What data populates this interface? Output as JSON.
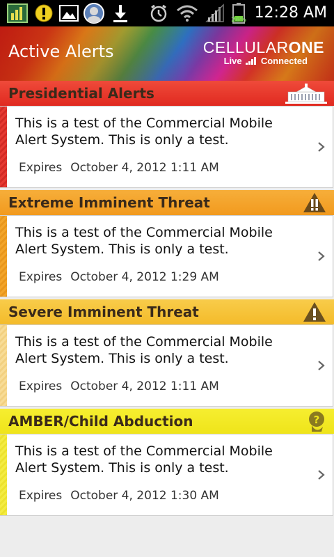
{
  "status_bar": {
    "time": "12:28 AM",
    "battery_percent": "26%",
    "icons": [
      "app-monitor-icon",
      "warning-notification-icon",
      "gallery-icon",
      "avatar-notification-icon",
      "download-icon",
      "alarm-icon",
      "wifi-icon",
      "signal-icon",
      "battery-icon"
    ]
  },
  "header": {
    "title": "Active Alerts",
    "logo_main_a": "CELLULAR",
    "logo_main_b": "ONE",
    "logo_sub_a": "Live",
    "logo_sub_b": "Connected"
  },
  "sections": [
    {
      "title": "Presidential Alerts",
      "icon": "white-house-icon",
      "color": "#e8382a",
      "strip_color": "#e02a2a",
      "alert": {
        "message": "This is a test of the Commercial Mobile Alert System. This is only a test.",
        "expires_label": "Expires",
        "expires_value": "October 4, 2012 1:11 AM"
      }
    },
    {
      "title": "Extreme Imminent Threat",
      "icon": "double-exclamation-warning-icon",
      "color": "#f4a024",
      "strip_color": "#f0a020",
      "alert": {
        "message": "This is a test of the Commercial Mobile Alert System. This is only a test.",
        "expires_label": "Expires",
        "expires_value": "October 4, 2012 1:29 AM"
      }
    },
    {
      "title": "Severe Imminent Threat",
      "icon": "exclamation-warning-icon",
      "color": "#f6c232",
      "strip_color": "#f7d88a",
      "alert": {
        "message": "This is a test of the Commercial Mobile Alert System. This is only a test.",
        "expires_label": "Expires",
        "expires_value": "October 4, 2012 1:11 AM"
      }
    },
    {
      "title": "AMBER/Child Abduction",
      "icon": "child-question-icon",
      "color": "#f4e81c",
      "strip_color": "#f2ea3a",
      "alert": {
        "message": "This is a test of the Commercial Mobile Alert System. This is only a test.",
        "expires_label": "Expires",
        "expires_value": "October 4, 2012 1:30 AM"
      }
    }
  ]
}
